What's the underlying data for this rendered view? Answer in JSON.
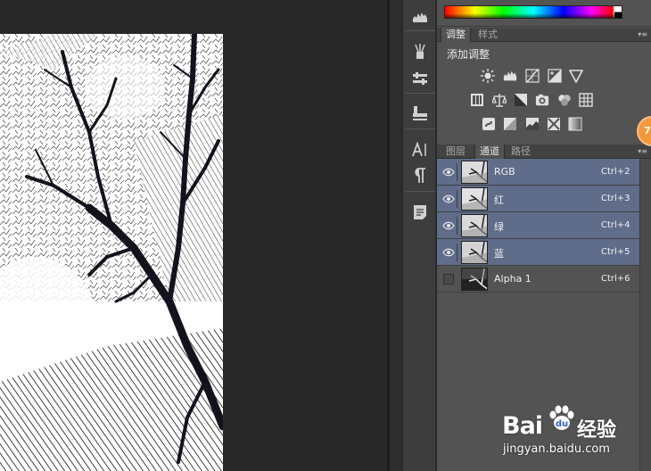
{
  "adjustments_panel": {
    "tabs": [
      {
        "label": "调整",
        "active": true
      },
      {
        "label": "样式",
        "active": false
      }
    ],
    "add_adjustment_label": "添加调整",
    "icons": [
      "brightness-contrast-icon",
      "levels-icon",
      "curves-icon",
      "exposure-icon",
      "vibrance-icon",
      "hue-saturation-icon",
      "color-balance-icon",
      "black-white-icon",
      "photo-filter-icon",
      "channel-mixer-icon",
      "color-lookup-icon",
      "invert-icon",
      "posterize-icon",
      "threshold-icon",
      "selective-color-icon",
      "gradient-map-icon"
    ]
  },
  "channels_panel": {
    "tabs": [
      {
        "label": "图层",
        "active": false
      },
      {
        "label": "通道",
        "active": true
      },
      {
        "label": "路径",
        "active": false
      }
    ],
    "channels": [
      {
        "name": "RGB",
        "shortcut": "Ctrl+2",
        "visible": true,
        "selected": true
      },
      {
        "name": "红",
        "shortcut": "Ctrl+3",
        "visible": true,
        "selected": true
      },
      {
        "name": "绿",
        "shortcut": "Ctrl+4",
        "visible": true,
        "selected": true
      },
      {
        "name": "蓝",
        "shortcut": "Ctrl+5",
        "visible": true,
        "selected": true
      },
      {
        "name": "Alpha 1",
        "shortcut": "Ctrl+6",
        "visible": false,
        "selected": false
      }
    ]
  },
  "toolbar": {
    "icons": [
      "histogram-icon",
      "brush-presets-icon",
      "tool-presets-icon",
      "clone-source-icon",
      "character-icon",
      "paragraph-icon",
      "notes-icon"
    ]
  },
  "watermark": {
    "brand": "Bai",
    "brand_suffix": "经验",
    "url": "jingyan.baidu.com"
  },
  "colors": {
    "selected_row": "#5f6c8a",
    "panel_bg": "#535353",
    "canvas_bg": "#282828",
    "badge": "#f29a3b"
  }
}
